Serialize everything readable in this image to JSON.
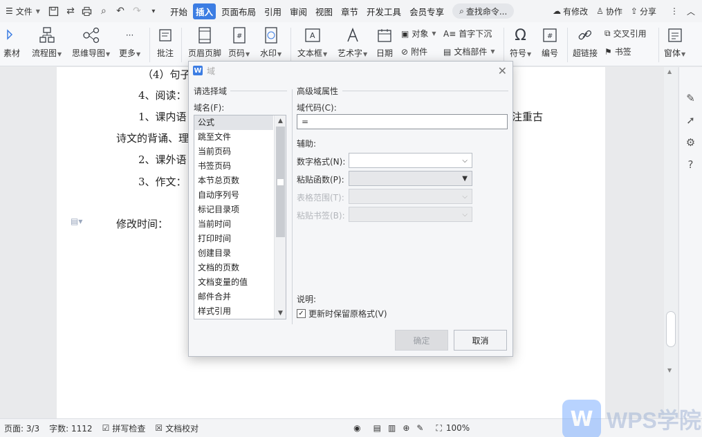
{
  "menubar": {
    "file_label": "文件",
    "tabs": [
      "开始",
      "插入",
      "页面布局",
      "引用",
      "审阅",
      "视图",
      "章节",
      "开发工具",
      "会员专享"
    ],
    "active_tab_index": 1,
    "search_label": "查找命令...",
    "right_items": [
      "有修改",
      "协作",
      "分享"
    ]
  },
  "ribbon": {
    "items": [
      {
        "label": "素材"
      },
      {
        "label": "流程图"
      },
      {
        "label": "思维导图"
      },
      {
        "label": "更多"
      },
      {
        "label": "批注"
      },
      {
        "label": "页眉页脚"
      },
      {
        "label": "页码"
      },
      {
        "label": "水印"
      },
      {
        "label": "文本框"
      },
      {
        "label": "艺术字"
      },
      {
        "label": "日期"
      },
      {
        "label": "符号"
      },
      {
        "label": "编号"
      },
      {
        "label": "超链接"
      },
      {
        "label": "窗体"
      }
    ],
    "small": {
      "object": "对象",
      "attachment": "附件",
      "dropcap": "首字下沉",
      "docpart": "文档部件",
      "crossref": "交叉引用",
      "bookmark": "书签"
    }
  },
  "document": {
    "lines": [
      "（4）句子",
      "4、阅读：",
      "1、课内语",
      "注重古",
      "诗文的背诵、理",
      "2、课外语",
      "3、作文：",
      "修改时间："
    ]
  },
  "dialog": {
    "title": "域",
    "left_group": "请选择域",
    "field_name_label": "域名(F):",
    "field_names": [
      "公式",
      "跳至文件",
      "当前页码",
      "书签页码",
      "本节总页数",
      "自动序列号",
      "标记目录项",
      "当前时间",
      "打印时间",
      "创建目录",
      "文档的页数",
      "文档变量的值",
      "邮件合并",
      "样式引用"
    ],
    "selected_index": 0,
    "right_group": "高级域属性",
    "field_code_label": "域代码(C):",
    "field_code_value": "=",
    "helper_label": "辅助:",
    "number_format_label": "数字格式(N):",
    "paste_func_label": "粘贴函数(P):",
    "table_range_label": "表格范围(T):",
    "paste_bookmark_label": "粘贴书签(B):",
    "description_label": "说明:",
    "keep_format_label": "更新时保留原格式(V)",
    "keep_format_checked": true,
    "ok_label": "确定",
    "cancel_label": "取消"
  },
  "statusbar": {
    "page": "页面: 3/3",
    "wordcount": "字数: 1112",
    "spellcheck": "拼写检查",
    "proofread": "文档校对",
    "zoom": "100%"
  },
  "watermark": {
    "logo_letter": "W",
    "text": "WPS学院"
  },
  "colors": {
    "accent": "#3c7de3"
  }
}
